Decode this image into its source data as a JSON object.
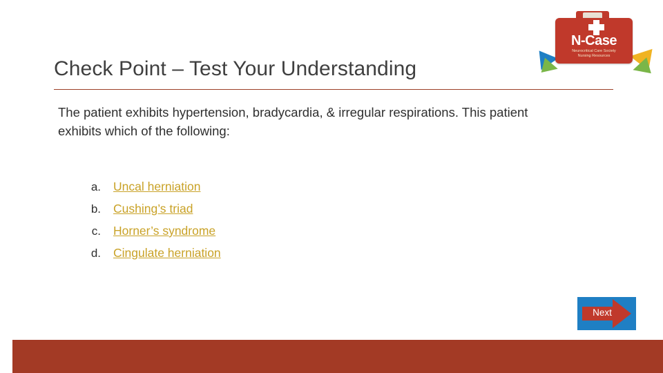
{
  "slide": {
    "title": "Check Point – Test Your Understanding",
    "question_stem": "The patient exhibits hypertension, bradycardia, & irregular respirations. This patient exhibits which of the following:",
    "answers": [
      {
        "marker": "a.",
        "text": "Uncal herniation"
      },
      {
        "marker": "b.",
        "text": "Cushing’s triad"
      },
      {
        "marker": "c.",
        "text": "Horner’s syndrome"
      },
      {
        "marker": "d.",
        "text": "Cingulate herniation"
      }
    ],
    "next_button": {
      "label": "Next",
      "icon": "right-arrow-icon"
    },
    "logo": {
      "title": "N-Case",
      "subtitle_line1": "Neurocritical Care Society",
      "subtitle_line2": "Nursing Resources",
      "icon": "medical-case-icon"
    },
    "colors": {
      "title_text": "#3f3f3f",
      "rule": "#9c3f26",
      "answer_link": "#c9a227",
      "footer_band": "#a33a25",
      "next_fill": "#1f7fc4",
      "next_arrow": "#c0392b",
      "logo_case": "#c0392b"
    }
  }
}
